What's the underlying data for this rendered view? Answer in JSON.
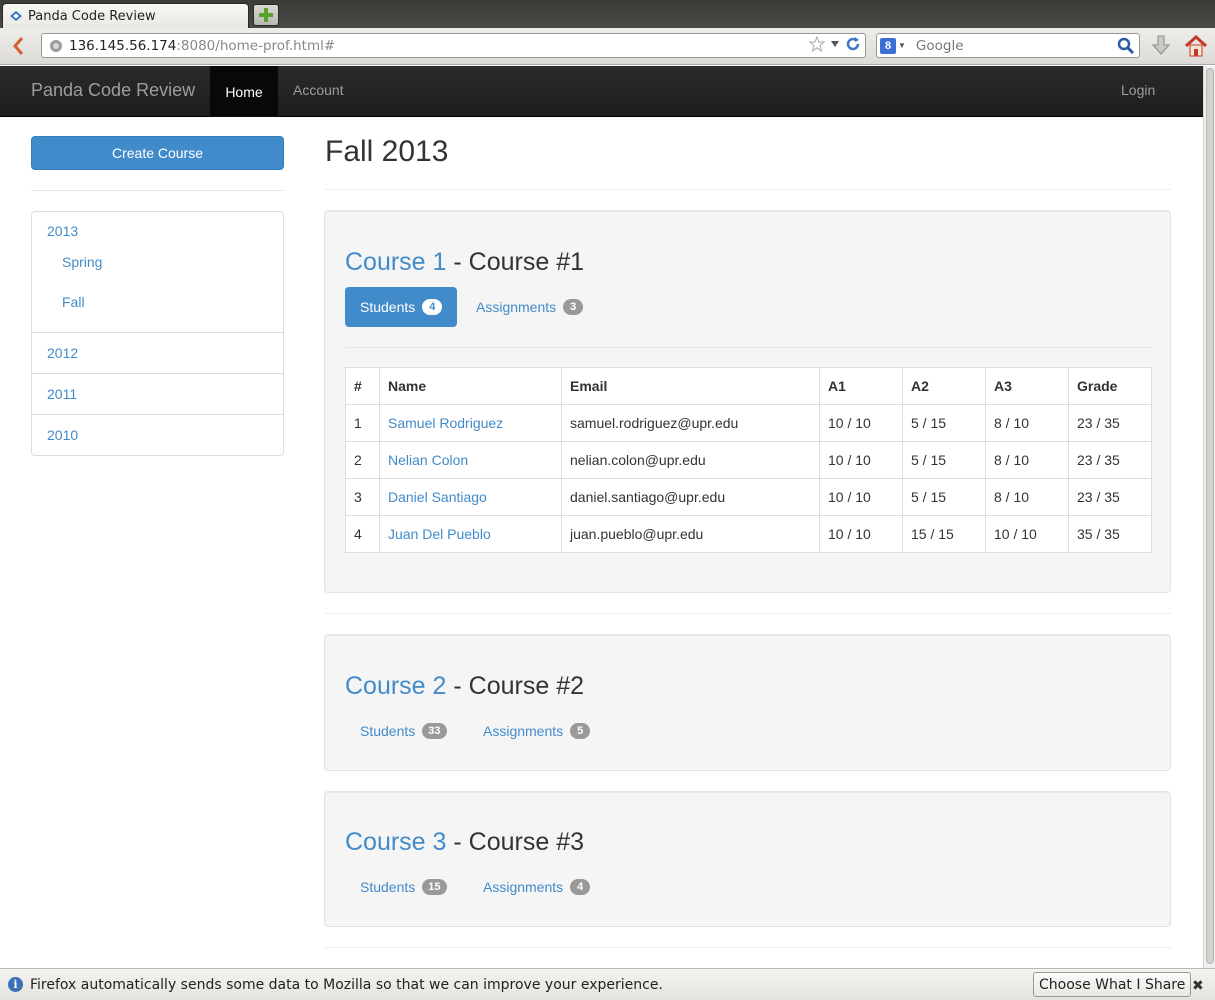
{
  "browser": {
    "tab_title": "Panda Code Review",
    "url_host": "136.145.56.174",
    "url_rest": ":8080/home-prof.html#",
    "search_placeholder": "Google",
    "search_engine_letter": "8"
  },
  "site": {
    "brand": "Panda Code Review",
    "nav": {
      "home": "Home",
      "account": "Account",
      "login": "Login"
    }
  },
  "sidebar": {
    "create_button": "Create Course",
    "years": [
      {
        "label": "2013",
        "semesters": [
          "Spring",
          "Fall"
        ]
      },
      {
        "label": "2012"
      },
      {
        "label": "2011"
      },
      {
        "label": "2010"
      }
    ]
  },
  "main": {
    "title": "Fall 2013",
    "courses": [
      {
        "link": "Course 1",
        "name": " - Course #1",
        "students_label": "Students",
        "students_count": "4",
        "assignments_label": "Assignments",
        "assignments_count": "3",
        "active_tab": "students",
        "table": {
          "headers": [
            "#",
            "Name",
            "Email",
            "A1",
            "A2",
            "A3",
            "Grade"
          ],
          "rows": [
            [
              "1",
              "Samuel Rodriguez",
              "samuel.rodriguez@upr.edu",
              "10 / 10",
              "5 / 15",
              "8 / 10",
              "23 / 35"
            ],
            [
              "2",
              "Nelian Colon",
              "nelian.colon@upr.edu",
              "10 / 10",
              "5 / 15",
              "8 / 10",
              "23 / 35"
            ],
            [
              "3",
              "Daniel Santiago",
              "daniel.santiago@upr.edu",
              "10 / 10",
              "5 / 15",
              "8 / 10",
              "23 / 35"
            ],
            [
              "4",
              "Juan Del Pueblo",
              "juan.pueblo@upr.edu",
              "10 / 10",
              "15 / 15",
              "10 / 10",
              "35 / 35"
            ]
          ]
        }
      },
      {
        "link": "Course 2",
        "name": " - Course #2",
        "students_label": "Students",
        "students_count": "33",
        "assignments_label": "Assignments",
        "assignments_count": "5"
      },
      {
        "link": "Course 3",
        "name": " - Course #3",
        "students_label": "Students",
        "students_count": "15",
        "assignments_label": "Assignments",
        "assignments_count": "4"
      }
    ]
  },
  "notification": {
    "text": "Firefox automatically sends some data to Mozilla so that we can improve your experience.",
    "button": "Choose What I Share",
    "icon_letter": "i"
  },
  "colors": {
    "primary": "#428bca",
    "navbar": "#222222",
    "well": "#f5f5f5"
  }
}
